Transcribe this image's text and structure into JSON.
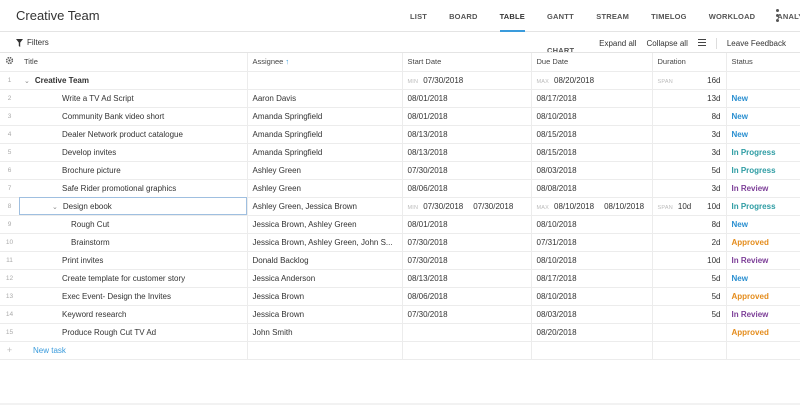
{
  "app": {
    "title": "Creative Team"
  },
  "nav": {
    "tabs": [
      "LIST",
      "BOARD",
      "TABLE",
      "GANTT CHART",
      "STREAM",
      "TIMELOG",
      "WORKLOAD",
      "ANALYTICS"
    ],
    "active": "TABLE"
  },
  "toolbar": {
    "filters": "Filters",
    "expand_all": "Expand all",
    "collapse_all": "Collapse all",
    "leave_feedback": "Leave Feedback"
  },
  "columns": {
    "title": "Title",
    "assignee": "Assignee",
    "start_date": "Start Date",
    "due_date": "Due Date",
    "duration": "Duration",
    "status": "Status"
  },
  "tags": {
    "min": "MIN",
    "max": "MAX",
    "span": "SPAN"
  },
  "rows": [
    {
      "num": "1",
      "title": "Creative Team",
      "assignee": "",
      "start": "07/30/2018",
      "due": "08/20/2018",
      "duration": "16d",
      "status": ""
    },
    {
      "num": "2",
      "title": "Write a TV Ad Script",
      "assignee": "Aaron Davis",
      "start": "08/01/2018",
      "due": "08/17/2018",
      "duration": "13d",
      "status": "New"
    },
    {
      "num": "3",
      "title": "Community Bank video short",
      "assignee": "Amanda Springfield",
      "start": "08/01/2018",
      "due": "08/10/2018",
      "duration": "8d",
      "status": "New"
    },
    {
      "num": "4",
      "title": "Dealer Network product catalogue",
      "assignee": "Amanda Springfield",
      "start": "08/13/2018",
      "due": "08/15/2018",
      "duration": "3d",
      "status": "New"
    },
    {
      "num": "5",
      "title": "Develop invites",
      "assignee": "Amanda Springfield",
      "start": "08/13/2018",
      "due": "08/15/2018",
      "duration": "3d",
      "status": "In Progress"
    },
    {
      "num": "6",
      "title": "Brochure picture",
      "assignee": "Ashley Green",
      "start": "07/30/2018",
      "due": "08/03/2018",
      "duration": "5d",
      "status": "In Progress"
    },
    {
      "num": "7",
      "title": "Safe Rider promotional graphics",
      "assignee": "Ashley Green",
      "start": "08/06/2018",
      "due": "08/08/2018",
      "duration": "3d",
      "status": "In Review"
    },
    {
      "num": "8",
      "title": "Design ebook",
      "assignee": "Ashley Green, Jessica Brown",
      "start_min": "07/30/2018",
      "start": "07/30/2018",
      "due_max": "08/10/2018",
      "due": "08/10/2018",
      "span": "10d",
      "duration": "10d",
      "status": "In Progress"
    },
    {
      "num": "9",
      "title": "Rough Cut",
      "assignee": "Jessica Brown, Ashley Green",
      "start": "08/01/2018",
      "due": "08/10/2018",
      "duration": "8d",
      "status": "New"
    },
    {
      "num": "10",
      "title": "Brainstorm",
      "assignee": "Jessica Brown, Ashley Green, John S...",
      "start": "07/30/2018",
      "due": "07/31/2018",
      "duration": "2d",
      "status": "Approved"
    },
    {
      "num": "11",
      "title": "Print invites",
      "assignee": "Donald Backlog",
      "start": "07/30/2018",
      "due": "08/10/2018",
      "duration": "10d",
      "status": "In Review"
    },
    {
      "num": "12",
      "title": "Create template for customer story",
      "assignee": "Jessica Anderson",
      "start": "08/13/2018",
      "due": "08/17/2018",
      "duration": "5d",
      "status": "New"
    },
    {
      "num": "13",
      "title": "Exec Event- Design the Invites",
      "assignee": "Jessica Brown",
      "start": "08/06/2018",
      "due": "08/10/2018",
      "duration": "5d",
      "status": "Approved"
    },
    {
      "num": "14",
      "title": "Keyword research",
      "assignee": "Jessica Brown",
      "start": "07/30/2018",
      "due": "08/03/2018",
      "duration": "5d",
      "status": "In Review"
    },
    {
      "num": "15",
      "title": "Produce Rough Cut TV Ad",
      "assignee": "John Smith",
      "start": "",
      "due": "08/20/2018",
      "duration": "",
      "status": "Approved"
    }
  ],
  "new_task": {
    "plus": "+",
    "label": "New task"
  },
  "colors": {
    "accent": "#3a9bdc",
    "new": "#2a8fd0",
    "in_progress": "#2d9ca3",
    "in_review": "#7d3f98",
    "approved": "#e48c1c"
  }
}
